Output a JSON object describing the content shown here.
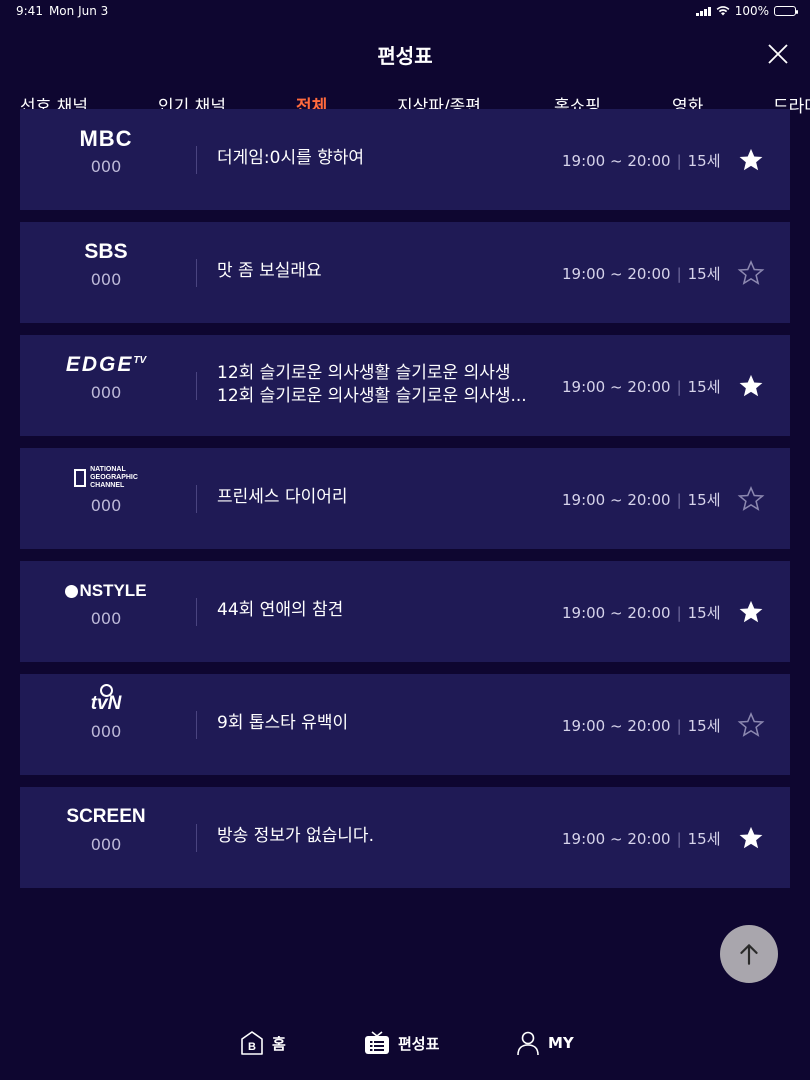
{
  "status": {
    "time": "9:41",
    "date": "Mon Jun 3",
    "battery": "100%"
  },
  "header": {
    "title": "편성표"
  },
  "tabs": [
    {
      "label": "선호 채널",
      "active": false
    },
    {
      "label": "인기 채널",
      "active": false
    },
    {
      "label": "전체",
      "active": true
    },
    {
      "label": "지상파/종편",
      "active": false
    },
    {
      "label": "홈쇼핑",
      "active": false
    },
    {
      "label": "영화",
      "active": false
    },
    {
      "label": "드라마",
      "active": false
    }
  ],
  "channels": [
    {
      "logo": "MBC",
      "number": "000",
      "program": "더게임:0시를 향하여",
      "program_line2": "",
      "time": "19:00 ~ 20:00",
      "rating": "15세",
      "favorite": true
    },
    {
      "logo": "SBS",
      "number": "000",
      "program": "맛 좀 보실래요",
      "program_line2": "",
      "time": "19:00 ~ 20:00",
      "rating": "15세",
      "favorite": false
    },
    {
      "logo": "EDGE TV",
      "number": "000",
      "program": "12회 슬기로운 의사생활 슬기로운 의사생",
      "program_line2": "12회 슬기로운 의사생활 슬기로운 의사생...",
      "time": "19:00 ~ 20:00",
      "rating": "15세",
      "favorite": true
    },
    {
      "logo": "NATIONAL GEOGRAPHIC CHANNEL",
      "number": "000",
      "program": "프린세스 다이어리",
      "program_line2": "",
      "time": "19:00 ~ 20:00",
      "rating": "15세",
      "favorite": false
    },
    {
      "logo": "ONSTYLE",
      "number": "000",
      "program": "44회 연애의 참견",
      "program_line2": "",
      "time": "19:00 ~ 20:00",
      "rating": "15세",
      "favorite": true
    },
    {
      "logo": "tvN",
      "number": "000",
      "program": "9회 톱스타 유백이",
      "program_line2": "",
      "time": "19:00 ~ 20:00",
      "rating": "15세",
      "favorite": false
    },
    {
      "logo": "SCREEN",
      "number": "000",
      "program": "방송 정보가 없습니다.",
      "program_line2": "",
      "time": "19:00 ~ 20:00",
      "rating": "15세",
      "favorite": true
    }
  ],
  "bottom_nav": [
    {
      "label": "홈",
      "icon": "home-icon"
    },
    {
      "label": "편성표",
      "icon": "tv-guide-icon"
    },
    {
      "label": "MY",
      "icon": "person-icon"
    }
  ],
  "colors": {
    "background": "#0e0630",
    "card": "#1f1a55",
    "accent": "#ff6a3d",
    "scroll_button": "#a9a6ad"
  }
}
